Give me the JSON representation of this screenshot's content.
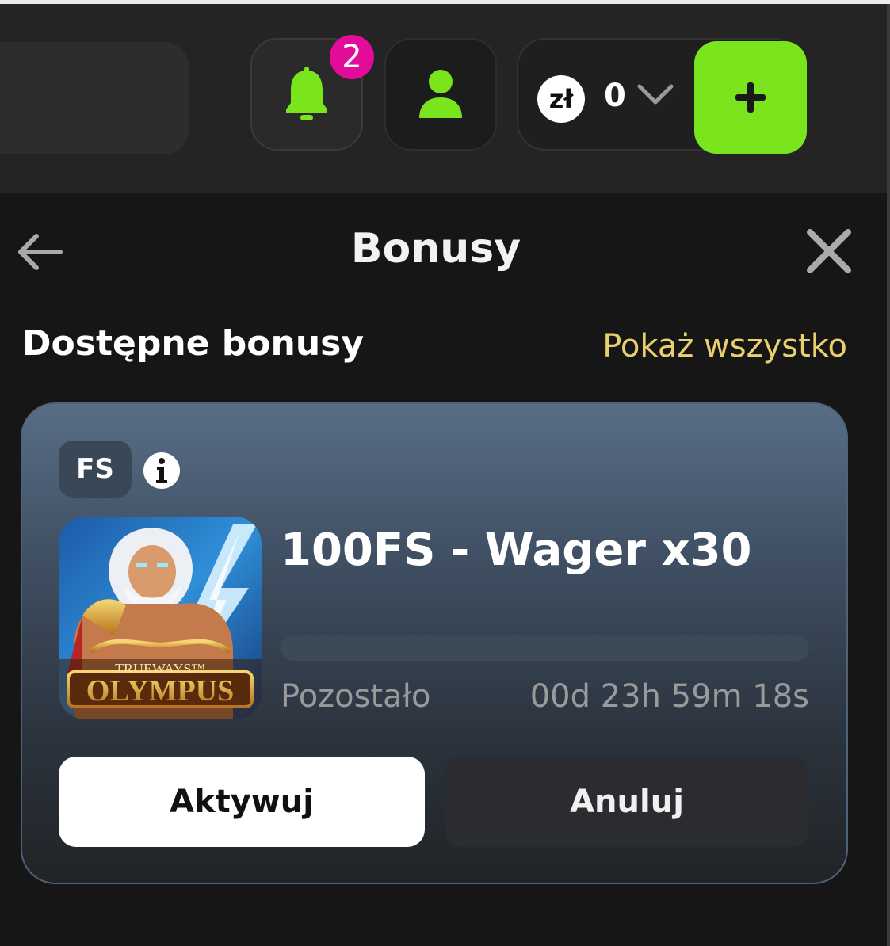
{
  "header": {
    "notifications_count": "2",
    "icons": {
      "notifications": "bell-icon",
      "profile": "user-icon",
      "deposit": "plus-icon",
      "balance_dropdown": "chevron-down-icon"
    },
    "balance": {
      "currency": "zł",
      "amount": "0"
    },
    "accent_color": "#7ae51c",
    "badge_color": "#e30c9a"
  },
  "panel": {
    "title": "Bonusy",
    "back_icon": "arrow-left-icon",
    "close_icon": "close-icon"
  },
  "section": {
    "title": "Dostępne bonusy",
    "show_all_label": "Pokaż wszystko",
    "show_all_color": "#e9d06f"
  },
  "bonus_card": {
    "type_tag": "FS",
    "info_icon": "info-icon",
    "game_logo_top": "TRUEWAYS™",
    "game_logo_main": "OLYMPUS",
    "name": "100FS - Wager x30",
    "progress_fraction": 0,
    "remaining_label": "Pozostało",
    "remaining_time": "00d 23h 59m 18s",
    "activate_label": "Aktywuj",
    "cancel_label": "Anuluj"
  }
}
